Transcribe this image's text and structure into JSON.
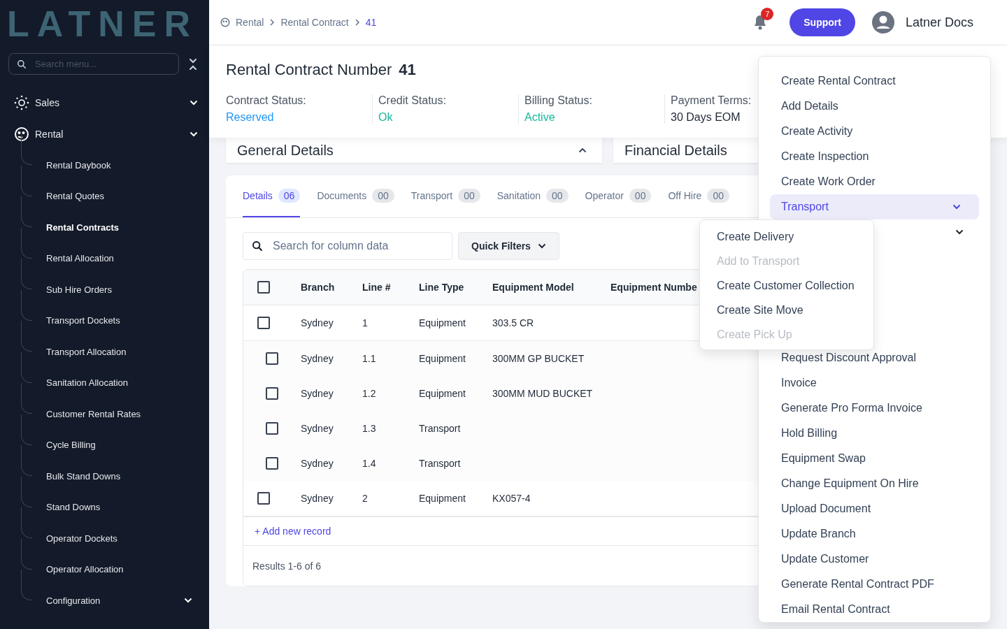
{
  "sidebar": {
    "logo": "LATNER",
    "search": {
      "placeholder": "Search menu..."
    },
    "items": [
      {
        "label": "Sales"
      },
      {
        "label": "Rental",
        "expanded": true,
        "children": [
          {
            "label": "Rental Daybook",
            "selected": false
          },
          {
            "label": "Rental Quotes",
            "selected": false
          },
          {
            "label": "Rental Contracts",
            "selected": true
          },
          {
            "label": "Rental Allocation",
            "selected": false
          },
          {
            "label": "Sub Hire Orders",
            "selected": false
          },
          {
            "label": "Transport Dockets",
            "selected": false
          },
          {
            "label": "Transport Allocation",
            "selected": false
          },
          {
            "label": "Sanitation Allocation",
            "selected": false
          },
          {
            "label": "Customer Rental Rates",
            "selected": false
          },
          {
            "label": "Cycle Billing",
            "selected": false
          },
          {
            "label": "Bulk Stand Downs",
            "selected": false
          },
          {
            "label": "Stand Downs",
            "selected": false
          },
          {
            "label": "Operator Dockets",
            "selected": false
          },
          {
            "label": "Operator Allocation",
            "selected": false
          },
          {
            "label": "Configuration",
            "selected": false,
            "expandable": true
          }
        ]
      }
    ]
  },
  "topbar": {
    "breadcrumb": [
      {
        "label": "Rental",
        "current": false
      },
      {
        "label": "Rental Contract",
        "current": false
      },
      {
        "label": "41",
        "current": true
      }
    ],
    "notifications": "7",
    "support": "Support",
    "user": "Latner Docs"
  },
  "header": {
    "title": "Rental Contract Number",
    "number": "41",
    "statuses": [
      {
        "label": "Contract Status:",
        "value": "Reserved",
        "color": "#2196f3"
      },
      {
        "label": "Credit Status:",
        "value": "Ok",
        "color": "#17b89c"
      },
      {
        "label": "Billing Status:",
        "value": "Active",
        "color": "#17b89c"
      },
      {
        "label": "Payment Terms:",
        "value": "30 Days EOM",
        "color": "#1f2937"
      }
    ]
  },
  "panels": [
    {
      "title": "General Details",
      "expanded": true
    },
    {
      "title": "Financial Details"
    }
  ],
  "tabs": [
    {
      "label": "Details",
      "count": "06",
      "selected": true
    },
    {
      "label": "Documents",
      "count": "00",
      "selected": false
    },
    {
      "label": "Transport",
      "count": "00",
      "selected": false
    },
    {
      "label": "Sanitation",
      "count": "00",
      "selected": false
    },
    {
      "label": "Operator",
      "count": "00",
      "selected": false
    },
    {
      "label": "Off Hire",
      "count": "00",
      "selected": false
    }
  ],
  "table": {
    "search": {
      "placeholder": "Search for column data"
    },
    "quick_filters": "Quick Filters",
    "header_checked": false,
    "columns": [
      "Branch",
      "Line #",
      "Line Type",
      "Equipment Model",
      "Equipment Numbe"
    ],
    "rows": [
      {
        "child": false,
        "checked": false,
        "cells": [
          "Sydney",
          "1",
          "Equipment",
          "303.5 CR"
        ]
      },
      {
        "child": true,
        "checked": false,
        "cells": [
          "Sydney",
          "1.1",
          "Equipment",
          "300MM GP BUCKET"
        ]
      },
      {
        "child": true,
        "checked": false,
        "cells": [
          "Sydney",
          "1.2",
          "Equipment",
          "300MM MUD BUCKET"
        ]
      },
      {
        "child": true,
        "checked": false,
        "cells": [
          "Sydney",
          "1.3",
          "Transport"
        ]
      },
      {
        "child": true,
        "checked": false,
        "cells": [
          "Sydney",
          "1.4",
          "Transport"
        ]
      },
      {
        "child": false,
        "checked": false,
        "cells": [
          "Sydney",
          "2",
          "Equipment",
          "KX057-4"
        ]
      }
    ],
    "add_record": "+ Add new record",
    "results": "Results 1-6 of 6"
  },
  "action_menu": {
    "items": [
      {
        "kind": "item",
        "label": "Create Rental Contract",
        "selected": false
      },
      {
        "kind": "item",
        "label": "Add Details",
        "selected": false
      },
      {
        "kind": "item",
        "label": "Create Activity",
        "selected": false
      },
      {
        "kind": "item",
        "label": "Create Inspection",
        "selected": false
      },
      {
        "kind": "item",
        "label": "Create Work Order",
        "selected": false
      },
      {
        "kind": "submenu",
        "label": "Transport",
        "selected": true,
        "expanded": true,
        "children": [
          {
            "label": "Create Delivery",
            "disabled": false
          },
          {
            "label": "Add to Transport",
            "disabled": true
          },
          {
            "label": "Create Customer Collection",
            "disabled": false
          },
          {
            "label": "Create Site Move",
            "disabled": false
          },
          {
            "label": "Create Pick Up",
            "disabled": true
          }
        ]
      },
      {
        "kind": "covered",
        "has_submenu": true
      },
      {
        "kind": "covered"
      },
      {
        "kind": "covered"
      },
      {
        "kind": "covered"
      },
      {
        "kind": "covered"
      },
      {
        "kind": "item",
        "label": "Request Discount Approval",
        "selected": false
      },
      {
        "kind": "item",
        "label": "Invoice",
        "selected": false
      },
      {
        "kind": "item",
        "label": "Generate Pro Forma Invoice",
        "selected": false
      },
      {
        "kind": "item",
        "label": "Hold Billing",
        "selected": false
      },
      {
        "kind": "item",
        "label": "Equipment Swap",
        "selected": false
      },
      {
        "kind": "item",
        "label": "Change Equipment On Hire",
        "selected": false
      },
      {
        "kind": "item",
        "label": "Upload Document",
        "selected": false
      },
      {
        "kind": "item",
        "label": "Update Branch",
        "selected": false
      },
      {
        "kind": "item",
        "label": "Update Customer",
        "selected": false
      },
      {
        "kind": "item",
        "label": "Generate Rental Contract PDF",
        "selected": false
      },
      {
        "kind": "item",
        "label": "Email Rental Contract",
        "selected": false
      }
    ]
  }
}
